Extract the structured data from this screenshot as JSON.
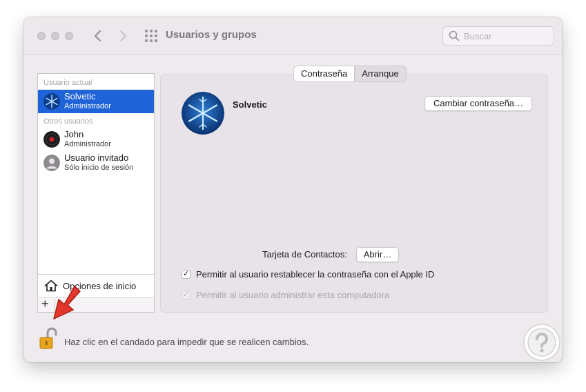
{
  "window": {
    "title": "Usuarios y grupos",
    "search_placeholder": "Buscar"
  },
  "sidebar": {
    "current_section_label": "Usuario actual",
    "other_section_label": "Otros usuarios",
    "current_user": {
      "name": "Solvetic",
      "role": "Administrador"
    },
    "other_users": [
      {
        "name": "John",
        "role": "Administrador"
      },
      {
        "name": "Usuario invitado",
        "role": "Sólo inicio de sesión"
      }
    ],
    "login_options_label": "Opciones de inicio",
    "add_label": "+"
  },
  "panel": {
    "tabs": [
      {
        "label": "Contraseña",
        "active": true
      },
      {
        "label": "Arranque",
        "active": false
      }
    ],
    "user_name": "Solvetic",
    "change_password_label": "Cambiar contraseña…",
    "contacts_label": "Tarjeta de Contactos:",
    "open_label": "Abrir…",
    "checkboxes": [
      {
        "label": "Permitir al usuario restablecer la contraseña con el Apple ID",
        "checked": true,
        "enabled": true
      },
      {
        "label": "Permitir al usuario administrar esta computadora",
        "checked": true,
        "enabled": false
      }
    ]
  },
  "footer": {
    "lock_text": "Haz clic en el candado para impedir que se realicen cambios."
  },
  "colors": {
    "selection": "#1f63d8",
    "window_bg": "#efeaee",
    "arrow": "#e2372c",
    "lock": "#e8a320"
  },
  "icons": {
    "close": "traffic-light-close-icon",
    "minimize": "traffic-light-minimize-icon",
    "zoom": "traffic-light-zoom-icon",
    "back": "chevron-left-icon",
    "forward": "chevron-right-icon",
    "grid": "grid-icon",
    "search": "search-icon",
    "home": "house-icon",
    "lock": "unlocked-padlock-icon",
    "pointer": "red-arrow-icon",
    "watermark": "help-question-icon"
  }
}
